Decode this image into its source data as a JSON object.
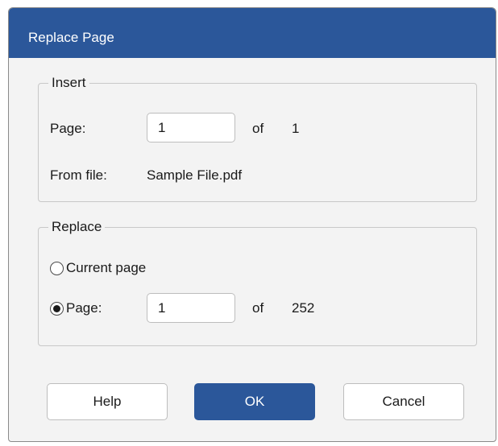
{
  "dialog": {
    "title": "Replace Page"
  },
  "insert": {
    "legend": "Insert",
    "page_label": "Page:",
    "page_value": "1",
    "of_label": "of",
    "page_total": "1",
    "from_file_label": "From file:",
    "from_file_value": "Sample File.pdf"
  },
  "replace": {
    "legend": "Replace",
    "current_page_label": "Current page",
    "current_page_selected": false,
    "page_label": "Page:",
    "page_selected": true,
    "page_value": "1",
    "of_label": "of",
    "page_total": "252"
  },
  "buttons": {
    "help": "Help",
    "ok": "OK",
    "cancel": "Cancel"
  },
  "colors": {
    "accent": "#2b579a",
    "dialog_bg": "#f3f3f3"
  }
}
